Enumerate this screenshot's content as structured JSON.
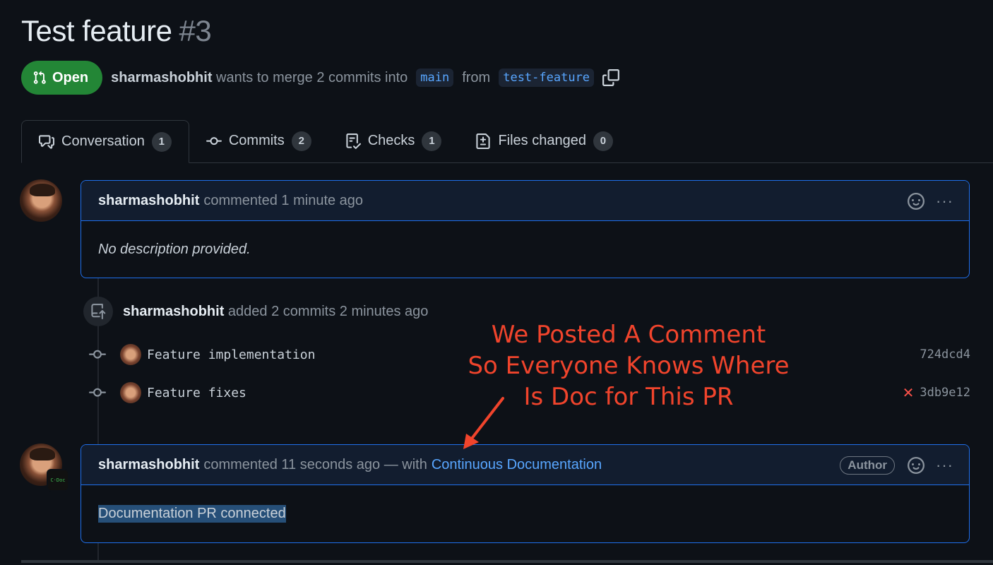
{
  "pr": {
    "title": "Test feature",
    "number": "#3",
    "state": "Open",
    "author": "sharmashobhit",
    "merge_text": "wants to merge 2 commits into",
    "base_branch": "main",
    "from_text": "from",
    "head_branch": "test-feature"
  },
  "tabs": [
    {
      "label": "Conversation",
      "count": "1",
      "icon": "comment-discussion-icon"
    },
    {
      "label": "Commits",
      "count": "2",
      "icon": "git-commit-icon"
    },
    {
      "label": "Checks",
      "count": "1",
      "icon": "checklist-icon"
    },
    {
      "label": "Files changed",
      "count": "0",
      "icon": "file-diff-icon"
    }
  ],
  "comment1": {
    "author": "sharmashobhit",
    "meta": "commented 1 minute ago",
    "body": "No description provided."
  },
  "commits_event": {
    "author": "sharmashobhit",
    "text": "added 2 commits 2 minutes ago",
    "commits": [
      {
        "message": "Feature implementation",
        "sha": "724dcd4",
        "status": ""
      },
      {
        "message": "Feature fixes",
        "sha": "3db9e12",
        "status": "✕"
      }
    ]
  },
  "comment2": {
    "author": "sharmashobhit",
    "meta": "commented 11 seconds ago — with",
    "app_link": "Continuous Documentation",
    "role_badge": "Author",
    "body": "Documentation PR connected",
    "app_badge": "C·Doc"
  },
  "annotation": {
    "lines": [
      "We Posted A Comment",
      "So Everyone Knows Where",
      "Is Doc for This PR"
    ],
    "color": "#f0442c"
  },
  "colors": {
    "background": "#0d1117",
    "open_green": "#238636",
    "link_blue": "#58a6ff",
    "comment_border": "#1f6feb"
  }
}
